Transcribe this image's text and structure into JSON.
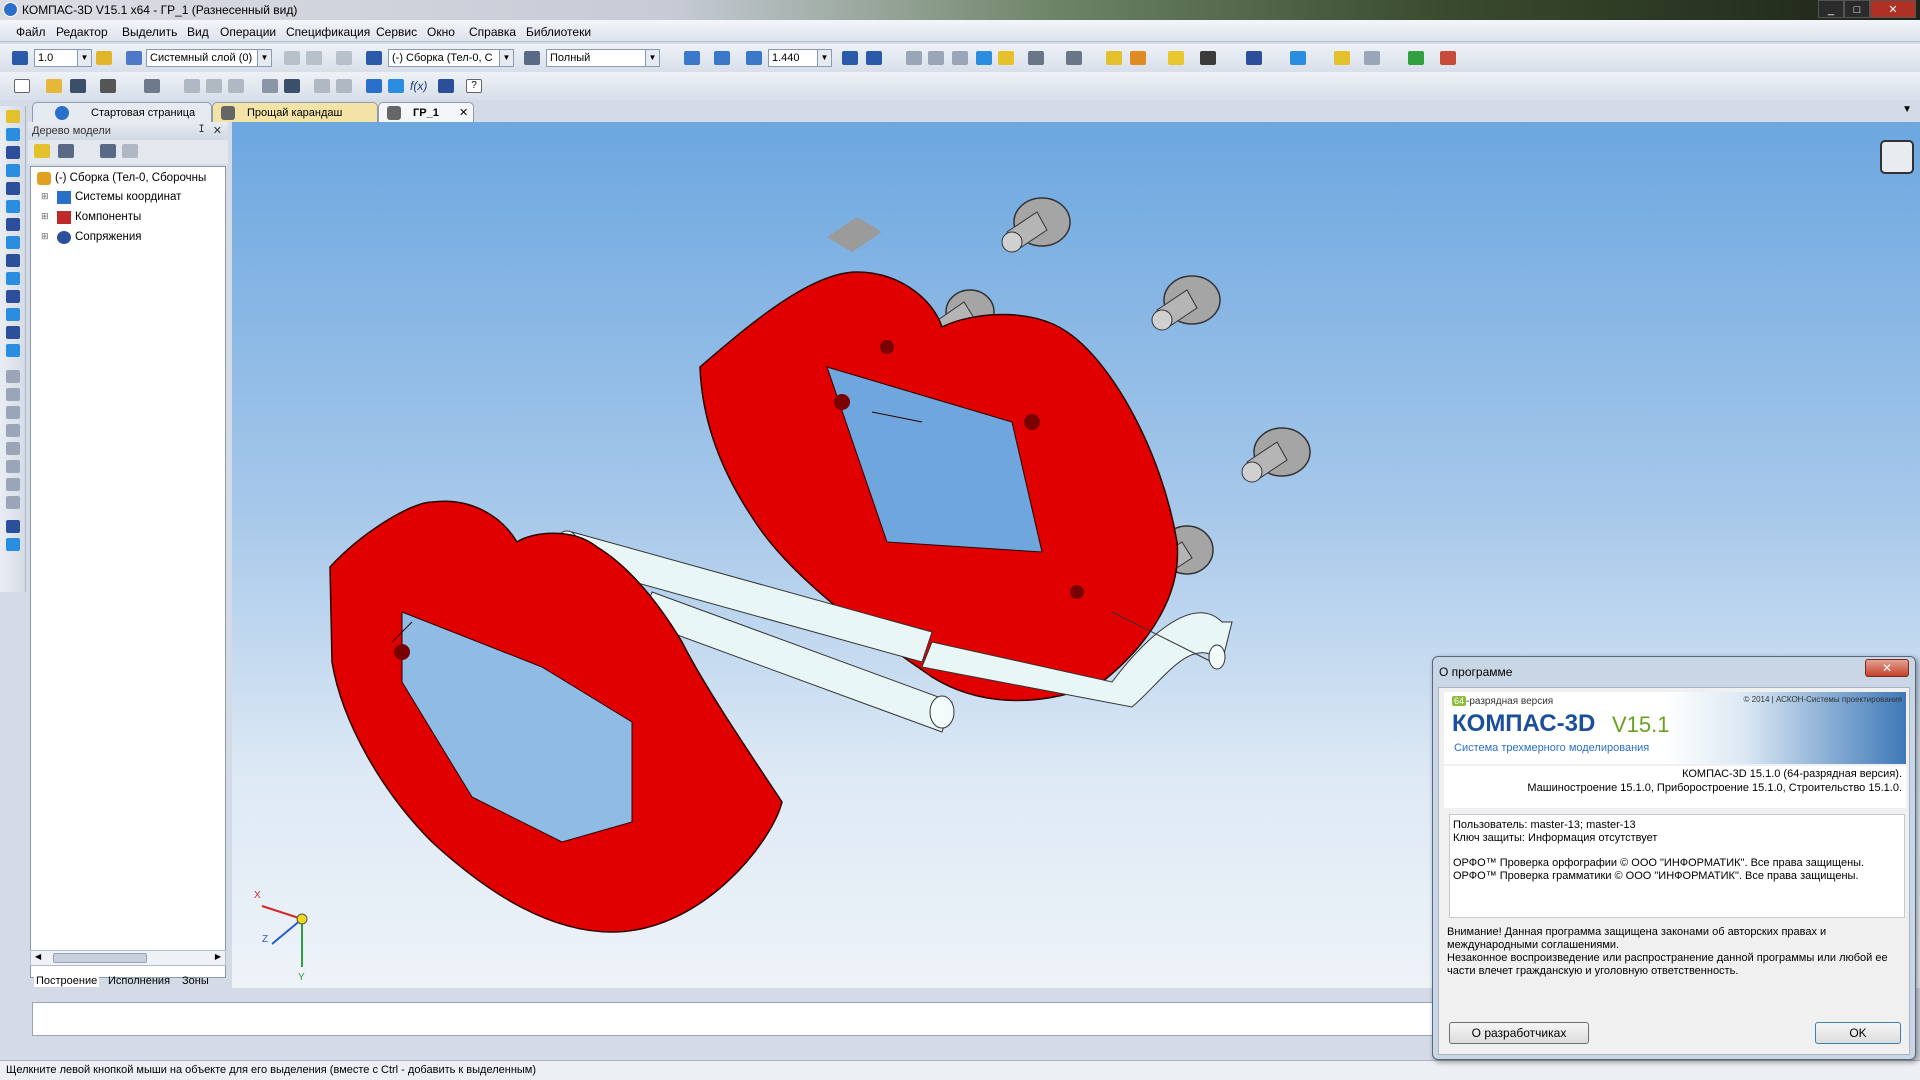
{
  "window": {
    "title": "КОМПАС-3D V15.1 x64 - ГР_1 (Разнесенный вид)"
  },
  "menu": [
    "Файл",
    "Редактор",
    "Выделить",
    "Вид",
    "Операции",
    "Спецификация",
    "Сервис",
    "Окно",
    "Справка",
    "Библиотеки"
  ],
  "toolbar1": {
    "step_value": "1.0",
    "layer_value": "Системный слой (0)",
    "state_value": "(-) Сборка (Тел-0, С",
    "style_value": "Полный",
    "zoom_value": "1.440"
  },
  "toolbar2": {
    "fx_label": "f(x)"
  },
  "tabs": [
    {
      "label": "Стартовая страница",
      "active": false
    },
    {
      "label": "Прощай карандаш",
      "active": false
    },
    {
      "label": "ГР_1",
      "active": true
    }
  ],
  "tree": {
    "header": "Дерево модели",
    "root": "(-) Сборка (Тел-0, Сборочны",
    "items": [
      "Системы координат",
      "Компоненты",
      "Сопряжения"
    ],
    "bottom_tabs": [
      "Построение",
      "Исполнения",
      "Зоны"
    ]
  },
  "axes": {
    "x": "X",
    "y": "Y",
    "z": "Z"
  },
  "status_hint": "Щелкните левой кнопкой мыши на объекте для его выделения (вместе с Ctrl - добавить к выделенным)",
  "about": {
    "title": "О программе",
    "bitness_badge": "64",
    "bitness_text": "-разрядная версия",
    "product": "КОМПАС-3D",
    "version": "V15.1",
    "subtitle": "Система трехмерного моделирования",
    "copyright": "© 2014 | АСКОН-Системы проектирования",
    "line1": "КОМПАС-3D 15.1.0 (64-разрядная версия).",
    "line2": "Машиностроение 15.1.0, Приборостроение 15.1.0, Строительство 15.1.0.",
    "user": "Пользователь: master-13; master-13",
    "key": "Ключ защиты: Информация отсутствует",
    "orfo1": "ОРФО™ Проверка орфографии © ООО \"ИНФОРМАТИК\". Все права защищены.",
    "orfo2": "ОРФО™ Проверка грамматики © ООО \"ИНФОРМАТИК\". Все права защищены.",
    "warn1": "Внимание! Данная программа защищена законами об авторских правах и",
    "warn2": "международными соглашениями.",
    "warn3": "Незаконное воспроизведение или распространение данной программы или любой ее",
    "warn4": "части влечет гражданскую и уголовную ответственность.",
    "dev_button": "О разработчиках",
    "ok_button": "OK"
  },
  "colors": {
    "part_red": "#e00000",
    "rod_white": "#e8f6f6",
    "viewport_top": "#6ca7e0"
  }
}
